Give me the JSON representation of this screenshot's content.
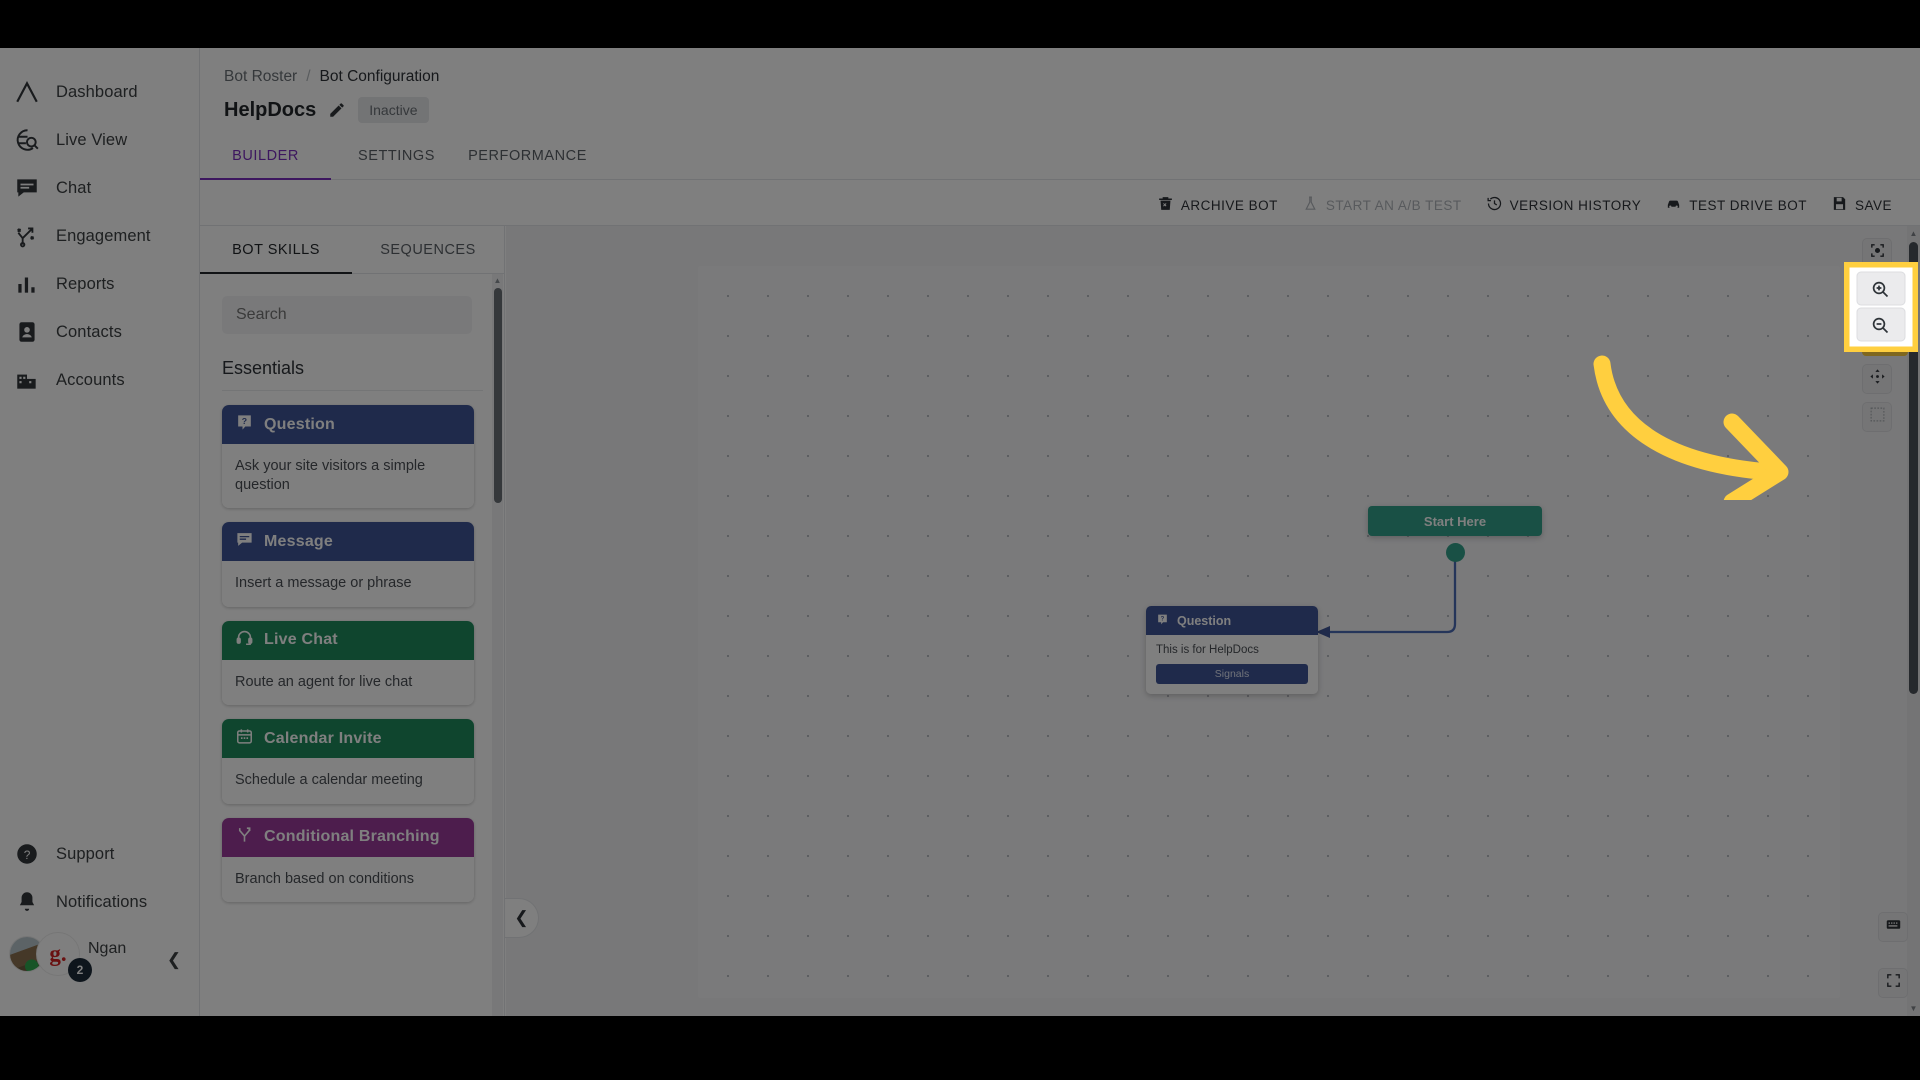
{
  "app": {
    "accent_purple": "#7b2fbe",
    "annotation_yellow": "#ffcf3f",
    "node_green": "#33a08a",
    "node_blue": "#3f5597"
  },
  "sidebar": {
    "items": [
      {
        "label": "Dashboard",
        "icon": "chevron-up-logo-icon"
      },
      {
        "label": "Live View",
        "icon": "globe-search-icon"
      },
      {
        "label": "Chat",
        "icon": "chat-bubble-icon"
      },
      {
        "label": "Engagement",
        "icon": "engagement-path-icon"
      },
      {
        "label": "Reports",
        "icon": "bar-chart-icon"
      },
      {
        "label": "Contacts",
        "icon": "contact-card-icon"
      },
      {
        "label": "Accounts",
        "icon": "building-icon"
      }
    ],
    "bottom_items": [
      {
        "label": "Support",
        "icon": "question-circle-icon"
      },
      {
        "label": "Notifications",
        "icon": "bell-icon"
      }
    ],
    "user": {
      "name": "Ngan",
      "brand_mark": "g.",
      "badge_count": "2"
    }
  },
  "header": {
    "breadcrumb": {
      "parent": "Bot Roster",
      "separator": "/",
      "current": "Bot Configuration"
    },
    "bot_name": "HelpDocs",
    "status": "Inactive",
    "tabs": [
      {
        "label": "BUILDER",
        "active": true
      },
      {
        "label": "SETTINGS",
        "active": false
      },
      {
        "label": "PERFORMANCE",
        "active": false
      }
    ]
  },
  "toolbar": {
    "buttons": [
      {
        "label": "ARCHIVE BOT",
        "icon": "trash-icon",
        "disabled": false
      },
      {
        "label": "START AN A/B TEST",
        "icon": "flask-icon",
        "disabled": true
      },
      {
        "label": "VERSION HISTORY",
        "icon": "history-clock-icon",
        "disabled": false
      },
      {
        "label": "TEST DRIVE BOT",
        "icon": "car-icon",
        "disabled": false
      },
      {
        "label": "SAVE",
        "icon": "floppy-disk-icon",
        "disabled": false
      }
    ]
  },
  "left_panel": {
    "tabs": [
      {
        "label": "BOT SKILLS",
        "active": true
      },
      {
        "label": "SEQUENCES",
        "active": false
      }
    ],
    "search_placeholder": "Search",
    "search_value": "",
    "section_heading": "Essentials",
    "skills": [
      {
        "title": "Question",
        "description": "Ask your site visitors a simple question",
        "color": "#3f5597",
        "icon": "question-badge-icon"
      },
      {
        "title": "Message",
        "description": "Insert a message or phrase",
        "color": "#3f5597",
        "icon": "message-lines-icon"
      },
      {
        "title": "Live Chat",
        "description": "Route an agent for live chat",
        "color": "#1f8a5c",
        "icon": "headset-icon"
      },
      {
        "title": "Calendar Invite",
        "description": "Schedule a calendar meeting",
        "color": "#1f8a5c",
        "icon": "calendar-icon"
      },
      {
        "title": "Conditional Branching",
        "description": "Branch based on conditions",
        "color": "#9b3b9b",
        "icon": "branch-fork-icon"
      }
    ],
    "collapse_icon": "chevron-left-icon"
  },
  "canvas": {
    "nodes": [
      {
        "type": "start",
        "label": "Start Here"
      },
      {
        "type": "question",
        "header": "Question",
        "body_text": "This is for HelpDocs",
        "button_label": "Signals"
      }
    ],
    "rail_top": [
      {
        "icon": "focus-center-icon",
        "name": "focus-center-button"
      }
    ],
    "rail_zoom": [
      {
        "icon": "zoom-in-icon",
        "name": "zoom-in-button"
      },
      {
        "icon": "zoom-out-icon",
        "name": "zoom-out-button"
      }
    ],
    "rail_mid": [
      {
        "icon": "move-arrows-icon",
        "name": "pan-mode-button"
      },
      {
        "icon": "select-region-icon",
        "name": "select-region-button"
      }
    ],
    "rail_bottom": [
      {
        "icon": "keyboard-icon",
        "name": "keyboard-shortcuts-button"
      },
      {
        "icon": "fullscreen-icon",
        "name": "fullscreen-button"
      }
    ]
  }
}
